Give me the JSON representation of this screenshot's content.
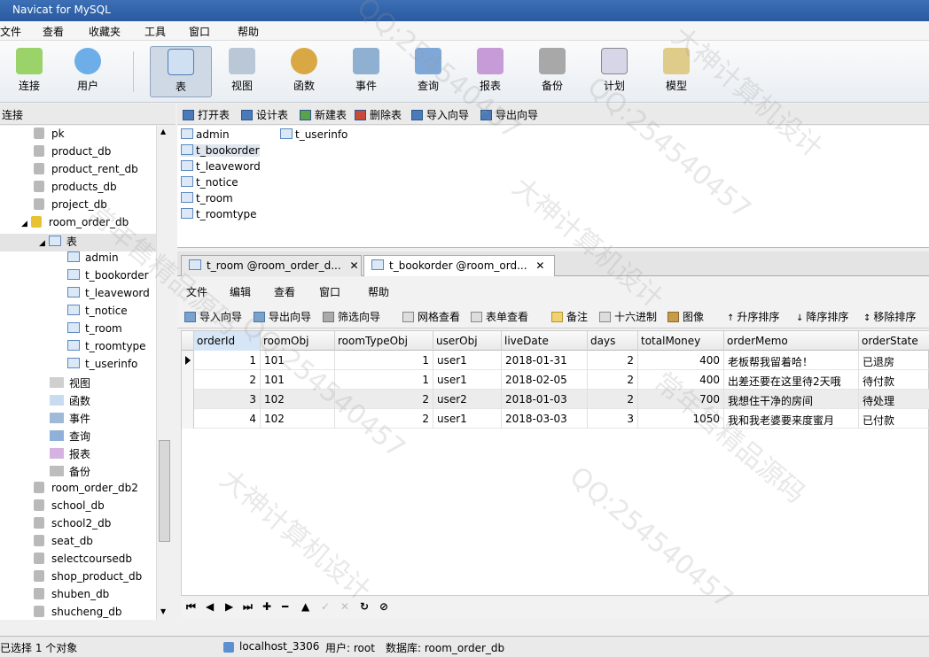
{
  "window": {
    "title": "Navicat for MySQL"
  },
  "menubar": [
    "文件",
    "查看",
    "收藏夹",
    "工具",
    "窗口",
    "帮助"
  ],
  "toolbar": [
    {
      "label": "连接",
      "icon": "connection-icon"
    },
    {
      "label": "用户",
      "icon": "user-icon"
    },
    {
      "label": "表",
      "icon": "table-icon",
      "active": true
    },
    {
      "label": "视图",
      "icon": "view-icon"
    },
    {
      "label": "函数",
      "icon": "function-icon"
    },
    {
      "label": "事件",
      "icon": "event-icon"
    },
    {
      "label": "查询",
      "icon": "query-icon"
    },
    {
      "label": "报表",
      "icon": "report-icon"
    },
    {
      "label": "备份",
      "icon": "backup-icon"
    },
    {
      "label": "计划",
      "icon": "schedule-icon"
    },
    {
      "label": "模型",
      "icon": "model-icon"
    }
  ],
  "connection_header": "连接",
  "object_toolbar": [
    "打开表",
    "设计表",
    "新建表",
    "删除表",
    "导入向导",
    "导出向导"
  ],
  "tree": {
    "dbs_before": [
      "pk",
      "product_db",
      "product_rent_db",
      "products_db",
      "project_db"
    ],
    "open_db": "room_order_db",
    "tables_node": "表",
    "tables": [
      "admin",
      "t_bookorder",
      "t_leaveword",
      "t_notice",
      "t_room",
      "t_roomtype",
      "t_userinfo"
    ],
    "other_nodes": [
      "视图",
      "函数",
      "事件",
      "查询",
      "报表",
      "备份"
    ],
    "dbs_after": [
      "room_order_db2",
      "school_db",
      "school2_db",
      "seat_db",
      "selectcoursedb",
      "shop_product_db",
      "shuben_db",
      "shucheng_db"
    ]
  },
  "object_list": [
    "admin",
    "t_bookorder",
    "t_leaveword",
    "t_notice",
    "t_room",
    "t_roomtype",
    "t_userinfo"
  ],
  "tabs": [
    {
      "label": "t_room @room_order_d...",
      "close": "✕"
    },
    {
      "label": "t_bookorder @room_ord...",
      "close": "✕",
      "active": true
    }
  ],
  "inner_menu": [
    "文件",
    "编辑",
    "查看",
    "窗口",
    "帮助"
  ],
  "inner_toolbar": [
    "导入向导",
    "导出向导",
    "筛选向导",
    "网格查看",
    "表单查看",
    "备注",
    "十六进制",
    "图像",
    "升序排序",
    "降序排序",
    "移除排序"
  ],
  "grid": {
    "columns": [
      "orderId",
      "roomObj",
      "roomTypeObj",
      "userObj",
      "liveDate",
      "days",
      "totalMoney",
      "orderMemo",
      "orderState"
    ],
    "rows": [
      [
        "1",
        "101",
        "1",
        "user1",
        "2018-01-31",
        "2",
        "400",
        "老板帮我留着哈！",
        "已退房"
      ],
      [
        "2",
        "101",
        "1",
        "user1",
        "2018-02-05",
        "2",
        "400",
        "出差还要在这里待2天哦",
        "待付款"
      ],
      [
        "3",
        "102",
        "2",
        "user2",
        "2018-01-03",
        "2",
        "700",
        "我想住干净的房间",
        "待处理"
      ],
      [
        "4",
        "102",
        "2",
        "user1",
        "2018-03-03",
        "3",
        "1050",
        "我和我老婆要来度蜜月",
        "已付款"
      ]
    ]
  },
  "nav_controls": [
    "⏮",
    "◀",
    "▶",
    "⏭",
    "✚",
    "━",
    "▲",
    "✓",
    "✕",
    "↻",
    "⊘"
  ],
  "status": {
    "selection": "已选择 1 个对象",
    "connection": "localhost_3306",
    "user": "用户: root",
    "database": "数据库: room_order_db"
  },
  "watermarks": [
    "大神计算机设计",
    "QQ:254540457",
    "常年售精品源码"
  ]
}
